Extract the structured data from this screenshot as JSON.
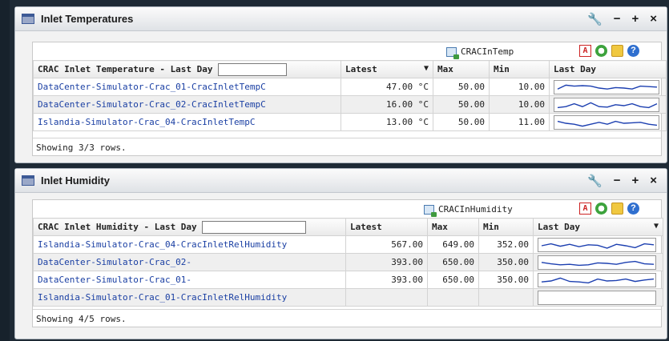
{
  "portlets": [
    {
      "title": "Inlet Temperatures",
      "controls": [
        "↖",
        "−",
        "+",
        "×"
      ],
      "csv_label": "CRACInTemp",
      "columns": [
        "CRAC Inlet Temperature - Last Day",
        "Latest",
        "Max",
        "Min",
        "Last Day"
      ],
      "sort_icon": "▼",
      "rows": [
        {
          "name": "DataCenter-Simulator-Crac_01-CracInletTempC",
          "latest": "47.00 °C",
          "max": "50.00",
          "min": "10.00",
          "spark": [
            0.6,
            0.2,
            0.3,
            0.25,
            0.3,
            0.5,
            0.6,
            0.45,
            0.5,
            0.6,
            0.3,
            0.35,
            0.4
          ]
        },
        {
          "name": "DataCenter-Simulator-Crac_02-CracInletTempC",
          "latest": "16.00 °C",
          "max": "50.00",
          "min": "10.00",
          "spark": [
            0.7,
            0.6,
            0.3,
            0.6,
            0.2,
            0.6,
            0.65,
            0.4,
            0.5,
            0.3,
            0.6,
            0.7,
            0.3
          ]
        },
        {
          "name": "Islandia-Simulator-Crac_04-CracInletTempC",
          "latest": "13.00 °C",
          "max": "50.00",
          "min": "11.00",
          "spark": [
            0.3,
            0.5,
            0.6,
            0.8,
            0.6,
            0.4,
            0.6,
            0.3,
            0.5,
            0.45,
            0.4,
            0.6,
            0.7
          ]
        }
      ],
      "status": "Showing 3/3 rows."
    },
    {
      "title": "Inlet Humidity",
      "controls": [
        "↖",
        "−",
        "+",
        "×"
      ],
      "csv_label": "CRACInHumidity",
      "columns": [
        "CRAC Inlet Humidity - Last Day",
        "Latest",
        "Max",
        "Min",
        "Last Day"
      ],
      "sort_icon": "▼",
      "rows": [
        {
          "name": "Islandia-Simulator-Crac_04-CracInletRelHumidity",
          "latest": "567.00",
          "max": "649.00",
          "min": "352.00",
          "spark": [
            0.5,
            0.3,
            0.55,
            0.35,
            0.6,
            0.4,
            0.45,
            0.75,
            0.35,
            0.5,
            0.7,
            0.3,
            0.4
          ]
        },
        {
          "name": "DataCenter-Simulator-Crac_02-",
          "latest": "393.00",
          "max": "650.00",
          "min": "350.00",
          "spark": [
            0.4,
            0.55,
            0.65,
            0.6,
            0.7,
            0.65,
            0.45,
            0.5,
            0.6,
            0.4,
            0.3,
            0.55,
            0.6
          ]
        },
        {
          "name": "DataCenter-Simulator-Crac_01-",
          "latest": "393.00",
          "max": "650.00",
          "min": "350.00",
          "spark": [
            0.6,
            0.5,
            0.2,
            0.55,
            0.6,
            0.7,
            0.3,
            0.5,
            0.45,
            0.3,
            0.55,
            0.4,
            0.3
          ]
        },
        {
          "name": "Islandia-Simulator-Crac_01-CracInletRelHumidity",
          "latest": "",
          "max": "",
          "min": "",
          "spark": []
        }
      ],
      "status": "Showing 4/5 rows."
    }
  ]
}
